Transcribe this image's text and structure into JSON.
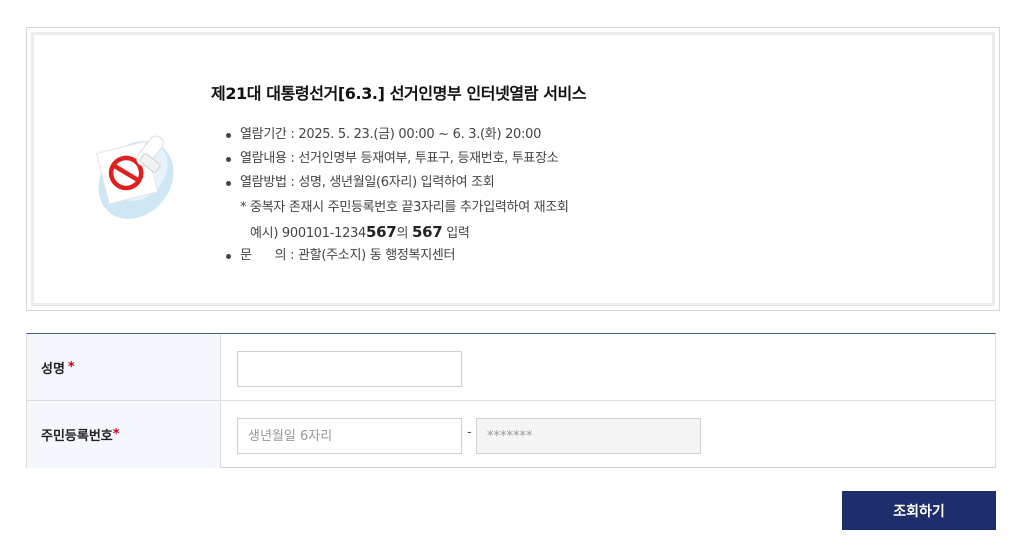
{
  "info": {
    "title": "제21대 대통령선거[6.3.] 선거인명부 인터넷열람 서비스",
    "items": [
      "열람기간 : 2025. 5. 23.(금) 00:00 ~ 6. 3.(화) 20:00",
      "열람내용 : 선거인명부 등재여부, 투표구, 등재번호, 투표장소",
      "열람방법 : 성명, 생년월일(6자리) 입력하여 조회"
    ],
    "note": "* 중복자 존재시 주민등록번호 끝3자리를 추가입력하여 재조회",
    "example": {
      "prefix": "예시) 900101-1234",
      "digits": "567",
      "middle": "의 ",
      "digits2": "567",
      "suffix": " 입력"
    },
    "contact": "문      의 : 관할(주소지) 동 행정복지센터"
  },
  "form": {
    "name_label": "성명",
    "name_value": "",
    "rrn_label": "주민등록번호",
    "required_mark": "*",
    "birth_placeholder": "생년월일 6자리",
    "birth_value": "",
    "separator": "-",
    "back_placeholder": "*******"
  },
  "submit_label": "조회하기",
  "colors": {
    "button": "#1e2d6b",
    "table_top_border": "#3f5a8f",
    "label_bg": "#f4f7fc",
    "required": "#d0021b"
  }
}
